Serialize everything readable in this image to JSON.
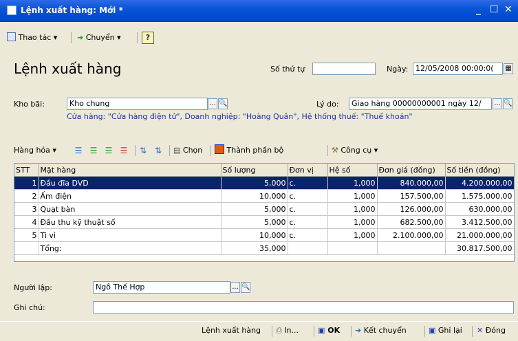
{
  "window": {
    "title": "Lệnh xuất hàng: Mới *",
    "min": "_",
    "max": "☐",
    "close": "✕"
  },
  "toolbar": {
    "actions": "Thao tác",
    "transfer": "Chuyển",
    "help": "?",
    "arrow": "▾"
  },
  "form": {
    "heading": "Lệnh xuất hàng",
    "seq_label": "Số thứ tự",
    "seq_value": "",
    "date_label": "Ngày:",
    "date_value": "12/05/2008 00:00:0(",
    "warehouse_label": "Kho bãi:",
    "warehouse_value": "Kho chung",
    "reason_label": "Lý do:",
    "reason_value": "Giao hàng 00000000001 ngày 12/",
    "info_line": "Cửa hàng: \"Cửa hàng điện tử\", Doanh nghiệp: \"Hoàng Quân\", Hệ thống thuế: \"Thuế khoán\"",
    "creator_label": "Người lập:",
    "creator_value": "Ngô Thế Hợp",
    "note_label": "Ghi chú:",
    "note_value": "",
    "lookup_btn": "...",
    "search_btn": "🔍"
  },
  "goods_toolbar": {
    "goods": "Hàng hóa",
    "choose": "Chọn",
    "components": "Thành phần bộ",
    "tools": "Công cụ"
  },
  "table": {
    "headers": [
      "STT",
      "Mặt hàng",
      "Số lượng",
      "Đơn vị",
      "Hệ số",
      "Đơn giá (đồng)",
      "Số tiền (đồng)"
    ],
    "rows": [
      [
        "1",
        "Đầu đĩa DVD",
        "5,000",
        "c.",
        "1,000",
        "840.000,00",
        "4.200.000,00"
      ],
      [
        "2",
        "Ấm điện",
        "10,000",
        "c.",
        "1,000",
        "157.500,00",
        "1.575.000,00"
      ],
      [
        "3",
        "Quạt bàn",
        "5,000",
        "c.",
        "1,000",
        "126.000,00",
        "630.000,00"
      ],
      [
        "4",
        "Đầu thu kỹ thuật số",
        "5,000",
        "c.",
        "1,000",
        "682.500,00",
        "3.412.500,00"
      ],
      [
        "5",
        "Ti vi",
        "10,000",
        "c.",
        "1,000",
        "2.100.000,00",
        "21.000.000,00"
      ]
    ],
    "total_label": "Tổng:",
    "total_qty": "35,000",
    "total_amount": "30.817.500,00"
  },
  "bottom": {
    "report": "Lệnh xuất hàng",
    "print": "In...",
    "ok": "OK",
    "carry": "Kết chuyển",
    "save": "Ghi lại",
    "close": "Đóng"
  },
  "colors": {
    "title_bg": "#0A54D8",
    "selection": "#0A246A",
    "info_text": "#1f2fa0",
    "form_bg": "#ECE9D8"
  }
}
